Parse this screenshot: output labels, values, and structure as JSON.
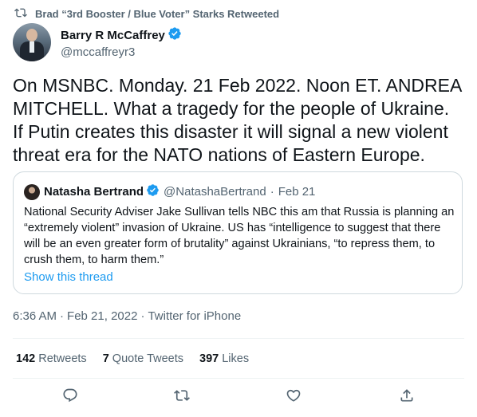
{
  "retweet": {
    "text": "Brad “3rd Booster / Blue Voter” Starks Retweeted"
  },
  "author": {
    "name": "Barry R McCaffrey",
    "handle": "@mccaffreyr3"
  },
  "tweet": {
    "text": "On MSNBC. Monday. 21 Feb 2022. Noon ET. ANDREA MITCHELL. What a tragedy for the people of Ukraine. If Putin creates this disaster it will signal a new violent threat era for the NATO nations of Eastern Europe."
  },
  "quote": {
    "name": "Natasha Bertrand",
    "handle": "@NatashaBertrand",
    "separator": "·",
    "date": "Feb 21",
    "text": "National Security Adviser Jake Sullivan tells NBC this am that Russia is planning an “extremely violent” invasion of Ukraine. US has “intelligence to suggest that there will be an even greater form of brutality” against Ukrainians, “to repress them, to crush them, to harm them.”",
    "show_thread": "Show this thread"
  },
  "meta": {
    "time": "6:36 AM",
    "sep1": "·",
    "date": "Feb 21, 2022",
    "sep2": "·",
    "source": "Twitter for iPhone"
  },
  "stats": {
    "retweets_count": "142",
    "retweets_label": "Retweets",
    "quotes_count": "7",
    "quotes_label": "Quote Tweets",
    "likes_count": "397",
    "likes_label": "Likes"
  },
  "icons": {
    "retweet": "retweet-icon",
    "verified": "verified-badge-icon",
    "reply": "reply-icon",
    "like": "heart-icon",
    "share": "share-icon"
  },
  "colors": {
    "accent": "#1d9bf0",
    "secondary_text": "#536471",
    "border": "#cfd9de"
  }
}
